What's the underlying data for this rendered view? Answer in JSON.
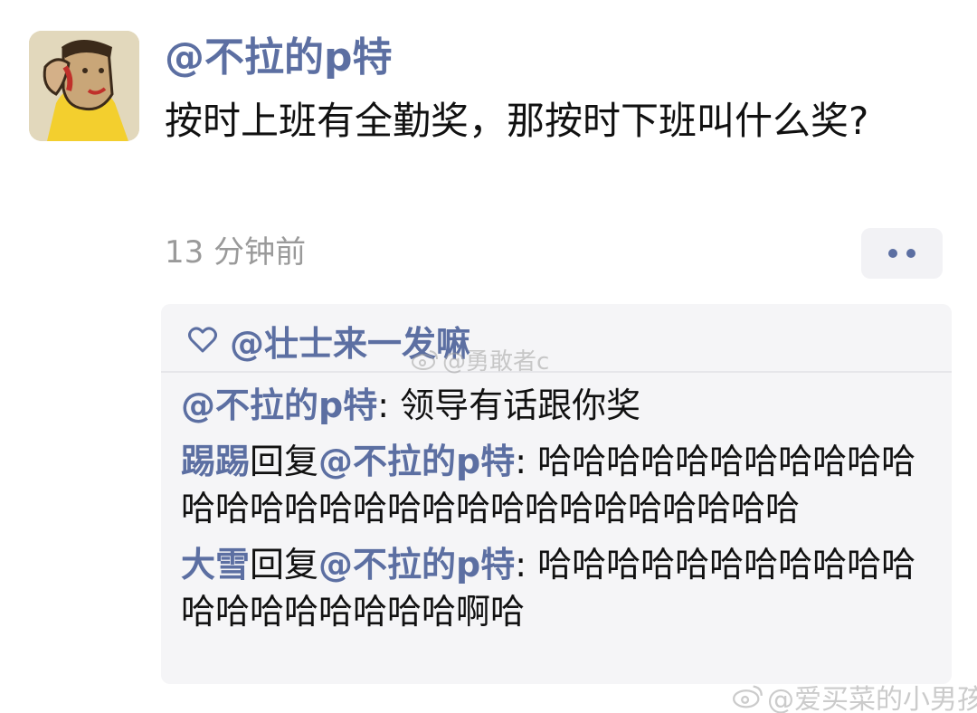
{
  "post": {
    "author": "@不拉的p特",
    "text": "按时上班有全勤奖，那按时下班叫什么奖?",
    "time": "13 分钟前"
  },
  "likes": {
    "icon": "heart-outline-icon",
    "user": "@壮士来一发嘛"
  },
  "comments": [
    {
      "name": "@不拉的p特",
      "reply_word": "",
      "reply_to": "",
      "sep": ": ",
      "text": "领导有话跟你奖"
    },
    {
      "name": "踢踢",
      "reply_word": "回复",
      "reply_to": "@不拉的p特",
      "sep": ": ",
      "text": "哈哈哈哈哈哈哈哈哈哈哈哈哈哈哈哈哈哈哈哈哈哈哈哈哈哈哈哈哈"
    },
    {
      "name": "大雪",
      "reply_word": "回复",
      "reply_to": "@不拉的p特",
      "sep": ": ",
      "text": "哈哈哈哈哈哈哈哈哈哈哈哈哈哈哈哈哈哈哈啊哈"
    }
  ],
  "watermarks": {
    "top": "@勇敢者c",
    "bottom": "@爱买菜的小男孩"
  },
  "colors": {
    "link": "#5c6fa2",
    "text": "#111111",
    "muted": "#9a9a9a",
    "panel_bg": "#f5f5f7"
  }
}
